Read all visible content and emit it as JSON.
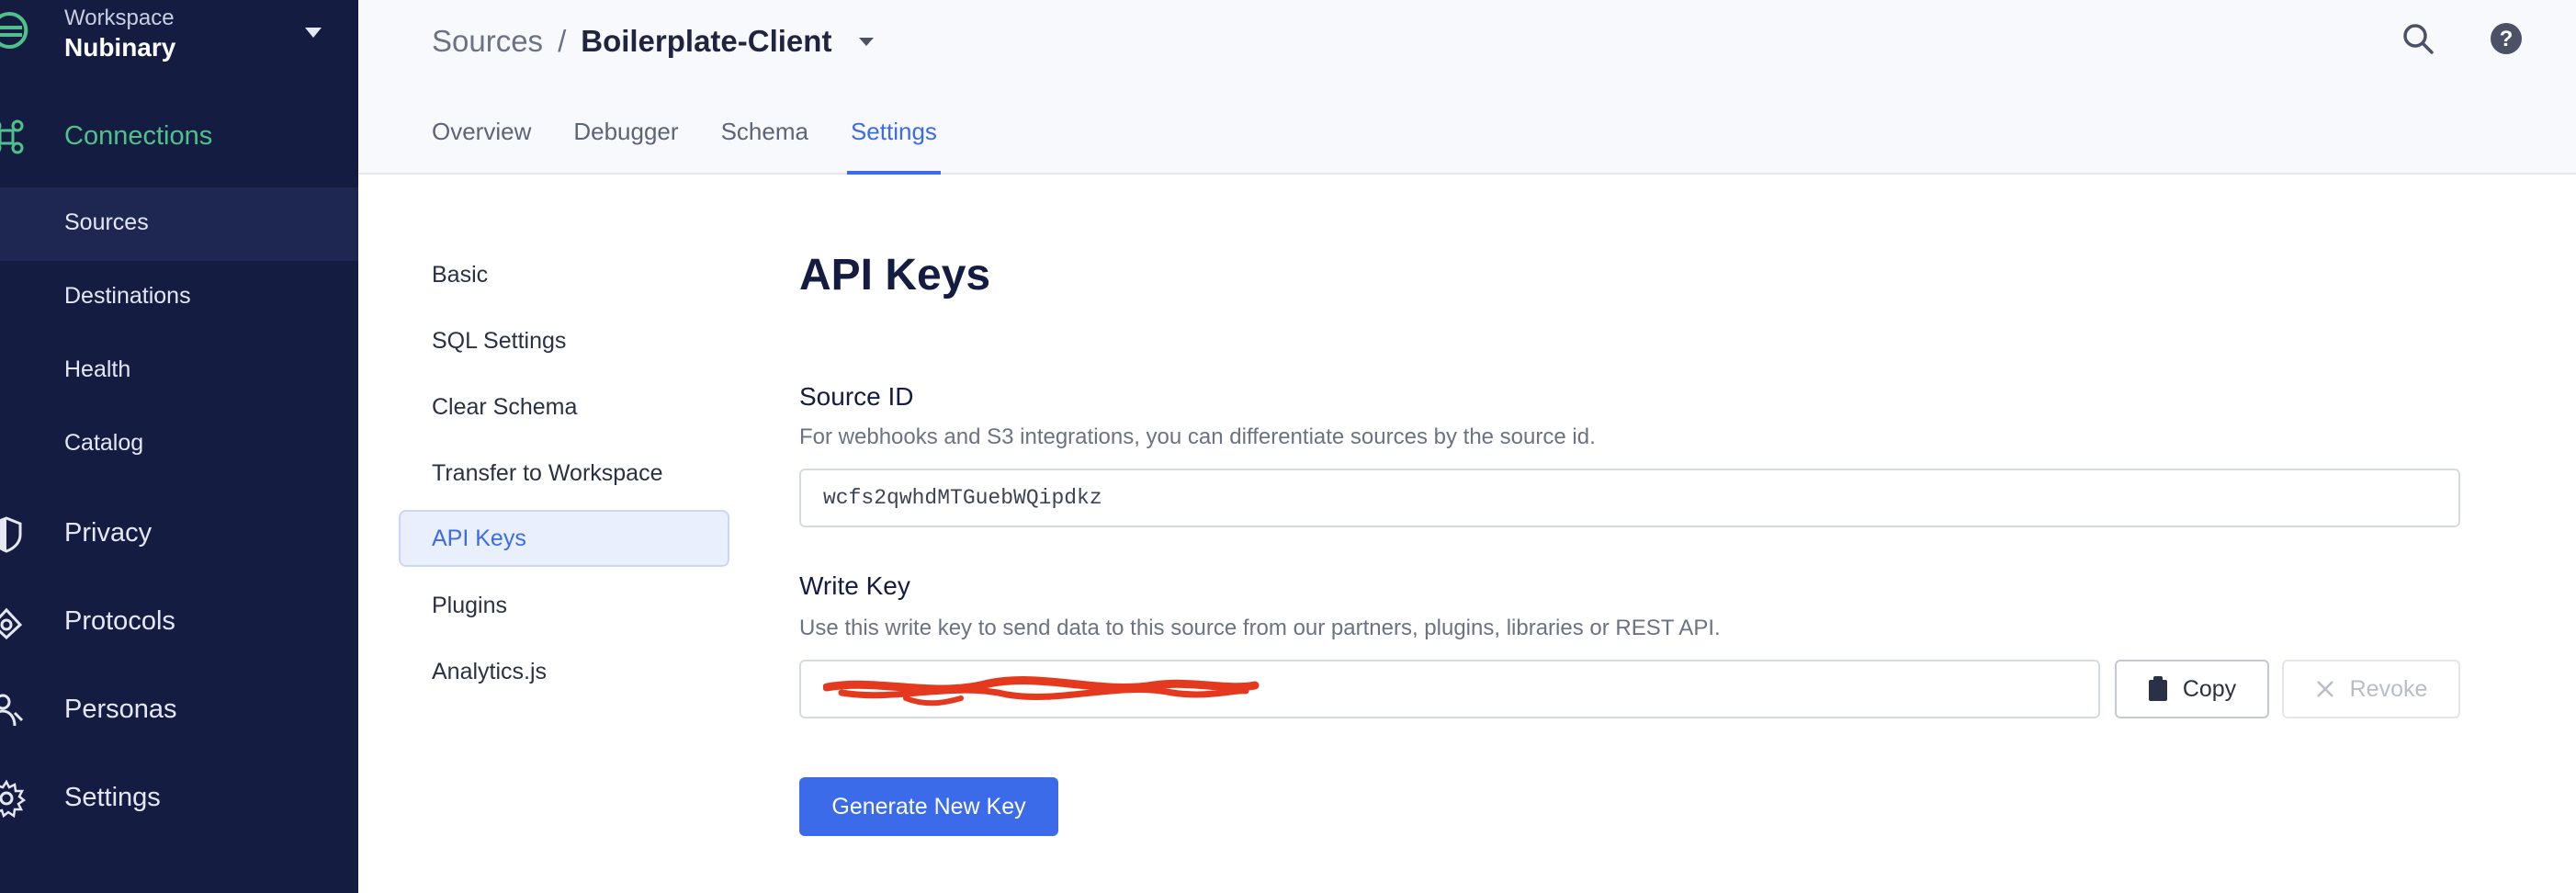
{
  "workspace": {
    "label": "Workspace",
    "name": "Nubinary"
  },
  "sidebar": {
    "main": [
      {
        "label": "Connections",
        "icon": "connections-icon",
        "active": true
      },
      {
        "label": "Privacy",
        "icon": "shield-icon"
      },
      {
        "label": "Protocols",
        "icon": "protocols-icon"
      },
      {
        "label": "Personas",
        "icon": "personas-icon"
      },
      {
        "label": "Settings",
        "icon": "gear-icon"
      }
    ],
    "sub": [
      {
        "label": "Sources",
        "active": true
      },
      {
        "label": "Destinations"
      },
      {
        "label": "Health"
      },
      {
        "label": "Catalog"
      }
    ]
  },
  "header": {
    "breadcrumb_root": "Sources",
    "breadcrumb_separator": "/",
    "breadcrumb_current": "Boilerplate-Client",
    "tabs": [
      {
        "label": "Overview"
      },
      {
        "label": "Debugger"
      },
      {
        "label": "Schema"
      },
      {
        "label": "Settings",
        "active": true
      }
    ]
  },
  "settings_menu": [
    {
      "label": "Basic"
    },
    {
      "label": "SQL Settings"
    },
    {
      "label": "Clear Schema"
    },
    {
      "label": "Transfer to Workspace"
    },
    {
      "label": "API Keys",
      "active": true
    },
    {
      "label": "Plugins"
    },
    {
      "label": "Analytics.js"
    }
  ],
  "content": {
    "title": "API Keys",
    "source_id": {
      "label": "Source ID",
      "help": "For webhooks and S3 integrations, you can differentiate sources by the source id.",
      "value": "wcfs2qwhdMTGuebWQipdkz"
    },
    "write_key": {
      "label": "Write Key",
      "help": "Use this write key to send data to this source from our partners, plugins, libraries or REST API.",
      "copy_label": "Copy",
      "revoke_label": "Revoke"
    },
    "generate_label": "Generate New Key"
  },
  "colors": {
    "sidebar_bg": "#141c42",
    "accent": "#3b6be8",
    "active_green": "#4fc28b",
    "redaction": "#e5391f"
  }
}
